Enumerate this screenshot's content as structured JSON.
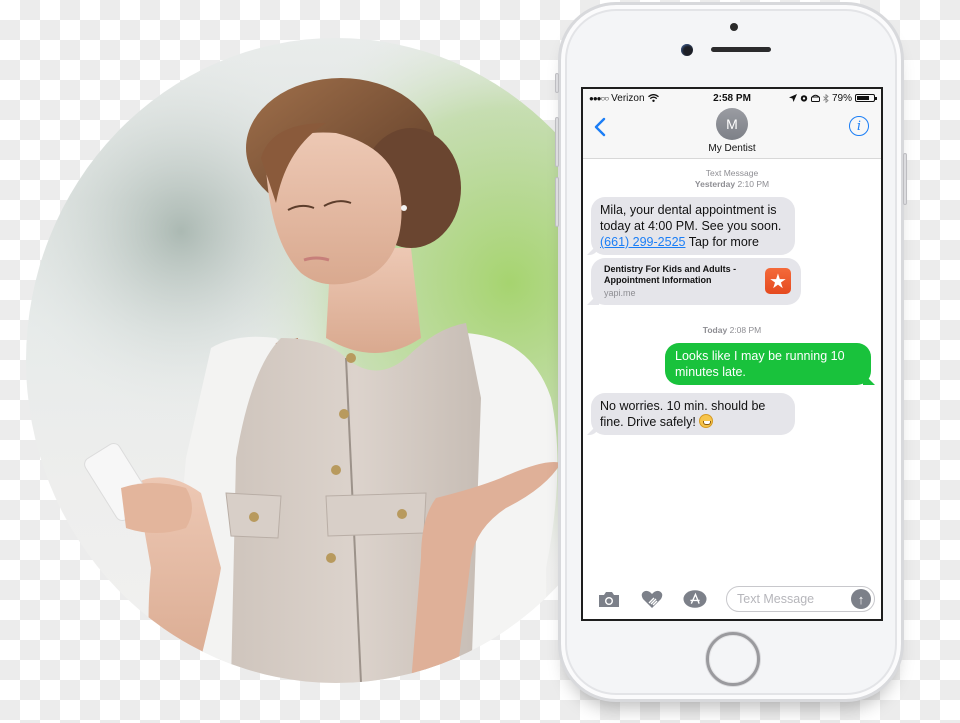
{
  "photo": {
    "subject": "woman looking at smartphone with confused expression, palm raised",
    "colors": {
      "skin": "#e4b9a2",
      "hair": "#8a5a3b",
      "vest": "#d2c8c1",
      "cardigan": "#f4f4f4",
      "strap": "#a85b35",
      "background_green": "#9fcf6a"
    }
  },
  "phone": {
    "status_bar": {
      "signal": "●●●○○",
      "carrier": "Verizon",
      "wifi_icon": "wifi-icon",
      "time": "2:58 PM",
      "icons": [
        "location-arrow-icon",
        "alarm-icon",
        "tty-icon",
        "bluetooth-icon"
      ],
      "battery_percent": "79%",
      "battery_level": 0.79
    },
    "header": {
      "back_icon": "chevron-left-icon",
      "avatar_initial": "M",
      "contact_name": "My Dentist",
      "info_icon": "info-circle-icon"
    },
    "thread": {
      "timestamp_1": {
        "service": "Text Message",
        "day": "Yesterday",
        "time": "2:10 PM"
      },
      "message_1": {
        "direction": "incoming",
        "text_before_link": "Mila, your dental appointment is today at 4:00 PM. See you soon. ",
        "link": "(661) 299-2525",
        "text_after_link": " Tap for more"
      },
      "link_preview": {
        "title": "Dentistry For Kids and Adults - Appointment Information",
        "domain": "yapi.me",
        "thumb_icon": "star-icon",
        "thumb_glyph": "★"
      },
      "timestamp_2": {
        "day": "Today",
        "time": "2:08 PM"
      },
      "message_2": {
        "direction": "outgoing",
        "text": "Looks like I may be running 10 minutes late."
      },
      "message_3": {
        "direction": "incoming",
        "text": "No worries. 10 min. should be fine. Drive safely! ",
        "emoji": "grinning-face-emoji"
      }
    },
    "compose": {
      "camera_icon": "camera-icon",
      "digital_touch_icon": "heart-hand-icon",
      "app_store_icon": "app-store-icon",
      "placeholder": "Text Message",
      "value": "",
      "send_icon": "arrow-up-icon",
      "send_glyph": "↑"
    },
    "colors": {
      "ios_blue": "#1b7ef6",
      "imessage_green": "#19c23c",
      "incoming_bubble": "#e5e5ea",
      "timestamp_gray": "#8e8e93"
    }
  }
}
